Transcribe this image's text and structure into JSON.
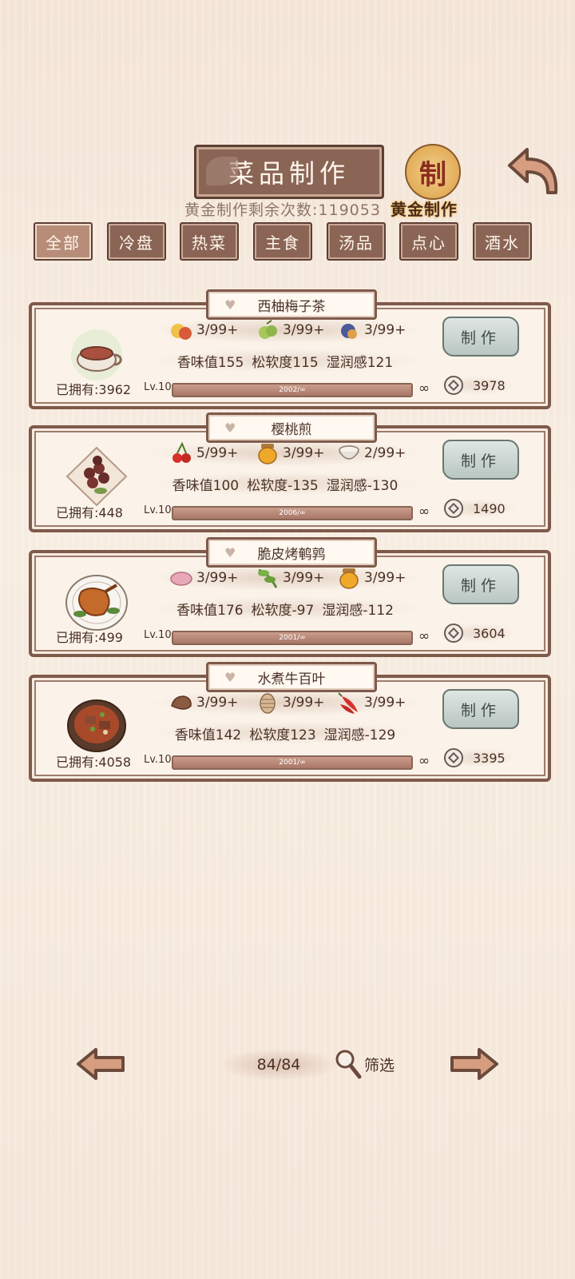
{
  "header": {
    "title": "菜品制作",
    "seal_char": "制",
    "gold_label": "黄金制作",
    "gold_count": "黄金制作剩余次数:119053"
  },
  "tabs": [
    "全部",
    "冷盘",
    "热菜",
    "主食",
    "汤品",
    "点心",
    "酒水"
  ],
  "active_tab": 0,
  "dishes": [
    {
      "name": "西柚梅子茶",
      "icon": "tea-bowl",
      "ingredients": [
        {
          "icon": "fruit-icon",
          "count": "3/99+"
        },
        {
          "icon": "plum-icon",
          "count": "3/99+"
        },
        {
          "icon": "fig-icon",
          "count": "3/99+"
        }
      ],
      "stats": [
        "香味值155",
        "松软度115",
        "湿润感121"
      ],
      "owned": "已拥有:3962",
      "level": "Lv.10",
      "xp": "2002/∞",
      "xp_fraction": 1.0,
      "infinite": "∞",
      "make": "制作",
      "price": "3978"
    },
    {
      "name": "樱桃煎",
      "icon": "cherry-plate",
      "ingredients": [
        {
          "icon": "cherry-icon",
          "count": "5/99+"
        },
        {
          "icon": "honey-jar-icon",
          "count": "3/99+"
        },
        {
          "icon": "rice-bowl-icon",
          "count": "2/99+"
        }
      ],
      "stats": [
        "香味值100",
        "松软度-135",
        "湿润感-130"
      ],
      "owned": "已拥有:448",
      "level": "Lv.10",
      "xp": "2006/∞",
      "xp_fraction": 1.0,
      "infinite": "∞",
      "make": "制作",
      "price": "1490"
    },
    {
      "name": "脆皮烤鹌鹑",
      "icon": "roast-quail",
      "ingredients": [
        {
          "icon": "meat-icon",
          "count": "3/99+"
        },
        {
          "icon": "greens-icon",
          "count": "3/99+"
        },
        {
          "icon": "honey-jar-icon",
          "count": "3/99+"
        }
      ],
      "stats": [
        "香味值176",
        "松软度-97",
        "湿润感-112"
      ],
      "owned": "已拥有:499",
      "level": "Lv.10",
      "xp": "2001/∞",
      "xp_fraction": 1.0,
      "infinite": "∞",
      "make": "制作",
      "price": "3604"
    },
    {
      "name": "水煮牛百叶",
      "icon": "beef-tripe-bowl",
      "ingredients": [
        {
          "icon": "beef-icon",
          "count": "3/99+"
        },
        {
          "icon": "tripe-icon",
          "count": "3/99+"
        },
        {
          "icon": "chili-icon",
          "count": "3/99+"
        }
      ],
      "stats": [
        "香味值142",
        "松软度123",
        "湿润感-129"
      ],
      "owned": "已拥有:4058",
      "level": "Lv.10",
      "xp": "2001/∞",
      "xp_fraction": 1.0,
      "infinite": "∞",
      "make": "制作",
      "price": "3395"
    }
  ],
  "pager": {
    "page": "84/84",
    "filter": "筛选"
  },
  "colors": {
    "frame": "#7e5a4b",
    "tab_bg": "#8a6556",
    "button_jade": "#b9c6c2"
  }
}
